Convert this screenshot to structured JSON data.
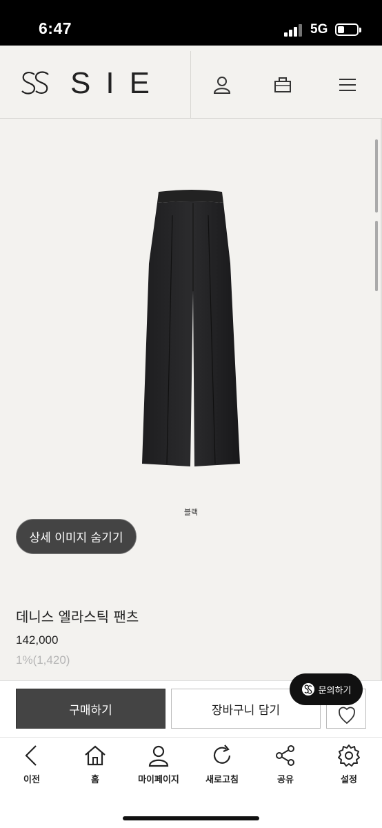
{
  "status_bar": {
    "time": "6:47",
    "network": "5G",
    "icons": [
      "signal-icon",
      "battery-icon"
    ]
  },
  "header": {
    "logo_text": "SIE",
    "icons": [
      "user-icon",
      "shopping-bag-icon",
      "menu-icon"
    ]
  },
  "product": {
    "image": "black-wide-pants",
    "color_label": "블랙",
    "hide_details_label": "상세 이미지 숨기기",
    "name": "데니스 엘라스틱 팬츠",
    "price": "142,000",
    "points": "1%(1,420)"
  },
  "actions": {
    "buy_label": "구매하기",
    "cart_label": "장바구니 담기",
    "wishlist_icon": "heart-icon",
    "inquiry_label": "문의하기"
  },
  "bottom_nav": {
    "items": [
      {
        "label": "이전",
        "icon": "back-icon"
      },
      {
        "label": "홈",
        "icon": "home-icon"
      },
      {
        "label": "마이페이지",
        "icon": "user-icon"
      },
      {
        "label": "새로고침",
        "icon": "refresh-icon"
      },
      {
        "label": "공유",
        "icon": "share-icon"
      },
      {
        "label": "설정",
        "icon": "gear-icon"
      }
    ]
  }
}
